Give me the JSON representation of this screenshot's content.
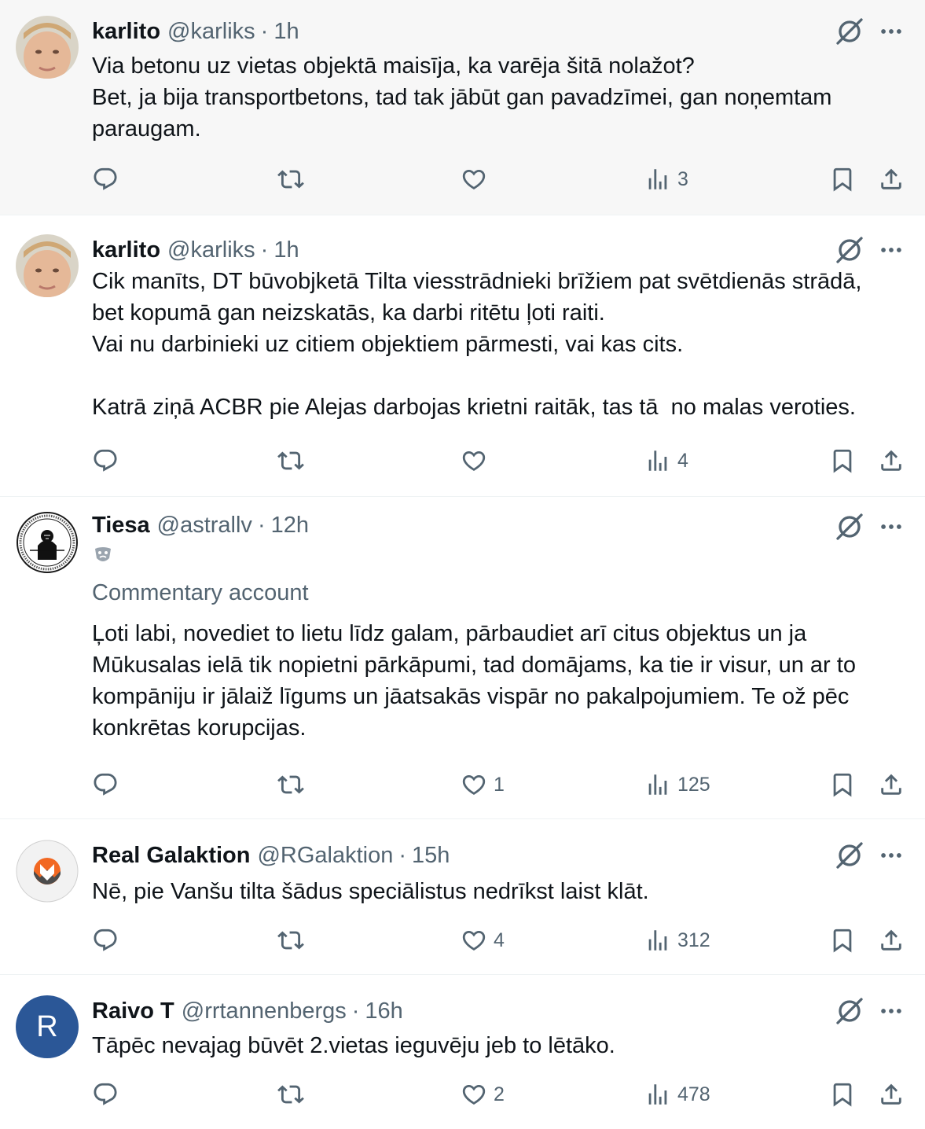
{
  "tweets": [
    {
      "name": "karlito",
      "handle": "@karliks",
      "time": "1h",
      "text": "Via betonu uz vietas objektā maisīja, ka varēja šitā nolažot?\nBet, ja bija transportbetons, tad tak jābūt gan pavadzīmei, gan noņemtam paraugam.",
      "likes": "",
      "views": "3",
      "avatar": "photo"
    },
    {
      "name": "karlito",
      "handle": "@karliks",
      "time": "1h",
      "text": "Cik manīts, DT būvobjketā Tilta viesstrādnieki brīžiem pat svētdienās strādā, bet kopumā gan neizskatās, ka darbi ritētu ļoti raiti.\nVai nu darbinieki uz citiem objektiem pārmesti, vai kas cits.\n\nKatrā ziņā ACBR pie Alejas darbojas krietni raitāk, tas tā  no malas veroties.",
      "likes": "",
      "views": "4",
      "avatar": "photo"
    },
    {
      "name": "Tiesa",
      "handle": "@astrallv",
      "time": "12h",
      "badge_icon": "theater-masks-icon",
      "subtitle": "Commentary account",
      "text": "Ļoti labi, novediet to lietu līdz galam, pārbaudiet arī citus objektus un ja Mūkusalas ielā tik nopietni pārkāpumi, tad domājams, ka tie ir visur, un ar to kompāniju ir jālaiž līgums un jāatsakās vispār no pakalpojumiem. Te ož pēc konkrētas korupcijas.",
      "likes": "1",
      "views": "125",
      "avatar": "seal"
    },
    {
      "name": "Real Galaktion",
      "handle": "@RGalaktion",
      "time": "15h",
      "text": "Nē, pie Vanšu tilta šādus speciālistus nedrīkst laist klāt.",
      "likes": "4",
      "views": "312",
      "avatar": "coin"
    },
    {
      "name": "Raivo T",
      "handle": "@rrtannenbergs",
      "time": "16h",
      "text": "Tāpēc nevajag būvēt 2.vietas ieguvēju jeb to lētāko.",
      "likes": "2",
      "views": "478",
      "avatar_letter": "R",
      "avatar": "letter"
    }
  ],
  "colors": {
    "text": "#0f1419",
    "secondary": "#536471",
    "highlight_bg": "#f7f7f7",
    "avatar_letter_bg": "#2b5797"
  },
  "icons": [
    "grok-icon",
    "more-icon",
    "reply-icon",
    "retweet-icon",
    "like-icon",
    "views-icon",
    "bookmark-icon",
    "share-icon"
  ]
}
